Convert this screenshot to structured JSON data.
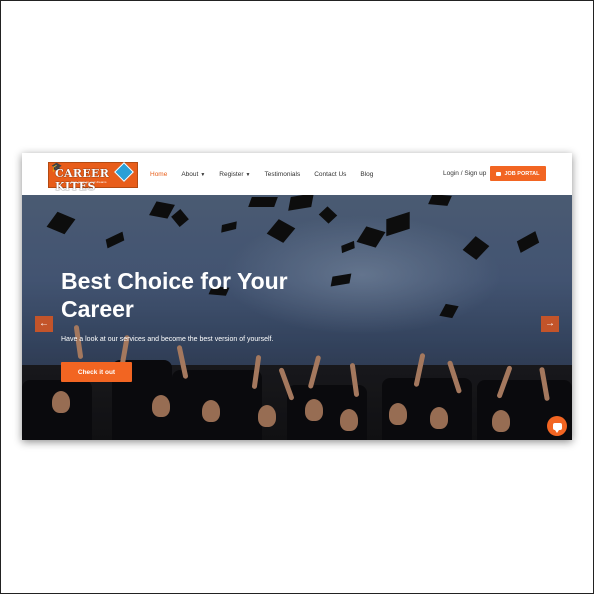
{
  "brand": {
    "logo_text": "CAREER KITES",
    "logo_tagline": "Give wings to your dreams"
  },
  "nav": {
    "items": [
      {
        "label": "Home",
        "active": true,
        "dropdown": false
      },
      {
        "label": "About",
        "active": false,
        "dropdown": true
      },
      {
        "label": "Register",
        "active": false,
        "dropdown": true
      },
      {
        "label": "Testimonials",
        "active": false,
        "dropdown": false
      },
      {
        "label": "Contact Us",
        "active": false,
        "dropdown": false
      },
      {
        "label": "Blog",
        "active": false,
        "dropdown": false
      }
    ],
    "login_label": "Login / Sign up",
    "job_portal_label": "JOB PORTAL"
  },
  "hero": {
    "title": "Best Choice for Your Career",
    "subtitle": "Have a look at our services and become the best version of yourself.",
    "cta_label": "Check it out",
    "prev_icon": "←",
    "next_icon": "→"
  },
  "colors": {
    "accent": "#f26522",
    "active_nav": "#e8601c"
  },
  "icons": {
    "briefcase": "briefcase-icon",
    "chat": "chat-icon",
    "caret": "caret-down-icon"
  }
}
